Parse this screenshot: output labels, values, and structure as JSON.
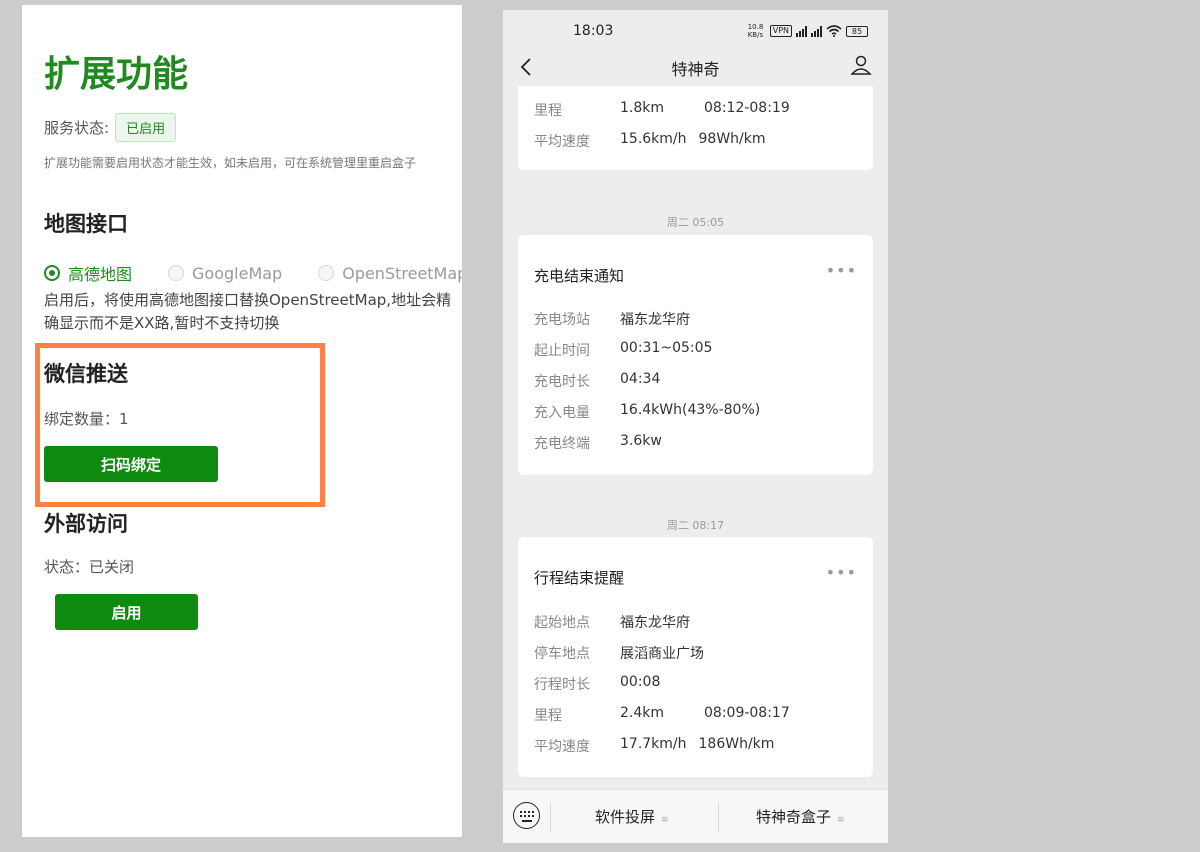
{
  "left": {
    "title": "扩展功能",
    "service_status_label": "服务状态:",
    "service_status_badge": "已启用",
    "hint": "扩展功能需要启用状态才能生效，如未启用，可在系统管理里重启盒子",
    "map": {
      "heading": "地图接口",
      "options": [
        {
          "label": "高德地图",
          "selected": true
        },
        {
          "label": "GoogleMap",
          "selected": false
        },
        {
          "label": "OpenStreetMap",
          "selected": false
        }
      ],
      "description": "启用后，将使用高德地图接口替换OpenStreetMap,地址会精确显示而不是XX路,暂时不支持切换"
    },
    "wechat": {
      "heading": "微信推送",
      "bind_count": "绑定数量：1",
      "bind_button": "扫码绑定"
    },
    "external": {
      "heading": "外部访问",
      "status": "状态：已关闭",
      "enable_button": "启用"
    },
    "highlight_color": "#ff7f45",
    "accent_color": "#0e8a0e"
  },
  "phone": {
    "status_bar": {
      "time": "18:03",
      "speed": "10.8 KB/s",
      "vpn": "VPN",
      "battery": "85"
    },
    "nav": {
      "title": "特神奇",
      "back_icon": "chevron-left-icon",
      "user_icon": "user-icon"
    },
    "partial_card": {
      "rows": [
        {
          "k": "里程",
          "v": "1.8km",
          "v2": "08:12-08:19"
        },
        {
          "k": "平均速度",
          "v": "15.6km/h",
          "v2": "98Wh/km"
        }
      ]
    },
    "timestamp1": "周二 05:05",
    "charge_card": {
      "title": "充电结束通知",
      "rows": [
        {
          "k": "充电场站",
          "v": "福东龙华府"
        },
        {
          "k": "起止时间",
          "v": "00:31~05:05"
        },
        {
          "k": "充电时长",
          "v": "04:34"
        },
        {
          "k": "充入电量",
          "v": "16.4kWh(43%-80%)"
        },
        {
          "k": "充电终端",
          "v": "3.6kw"
        }
      ]
    },
    "timestamp2": "周二 08:17",
    "trip_card": {
      "title": "行程结束提醒",
      "rows": [
        {
          "k": "起始地点",
          "v": "福东龙华府"
        },
        {
          "k": "停车地点",
          "v": "展滔商业广场"
        },
        {
          "k": "行程时长",
          "v": "00:08"
        },
        {
          "k": "里程",
          "v": "2.4km",
          "v2": "08:09-08:17"
        },
        {
          "k": "平均速度",
          "v": "17.7km/h",
          "v2": "186Wh/km"
        }
      ]
    },
    "bottom_bar": {
      "keyboard_icon": "keyboard-icon",
      "menu1": "软件投屏",
      "menu2": "特神奇盒子",
      "menu_marker": "≡"
    }
  }
}
